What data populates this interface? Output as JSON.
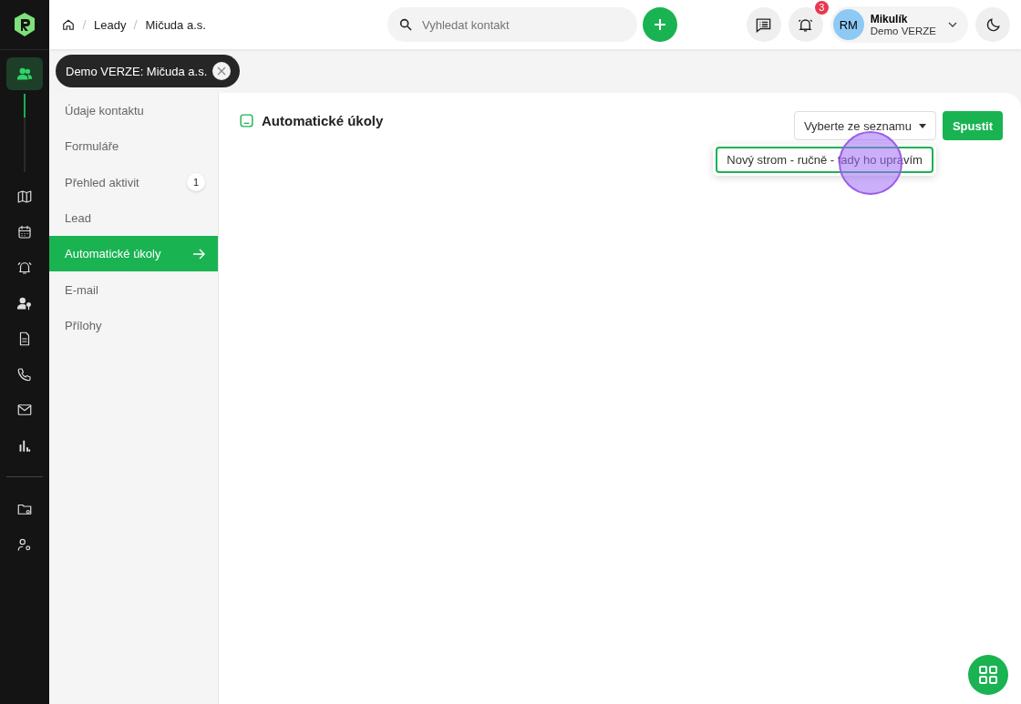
{
  "breadcrumb": [
    "Leady",
    "Mičuda a.s."
  ],
  "search": {
    "placeholder": "Vyhledat kontakt"
  },
  "notifications": {
    "count": "3"
  },
  "user": {
    "initials": "RM",
    "name": "Mikulík",
    "company": "Demo VERZE"
  },
  "rail": [
    {
      "selected": true
    },
    {
      "selected": false
    },
    {
      "selected": false
    },
    {
      "selected": false
    },
    {
      "selected": false
    },
    {
      "selected": false
    },
    {
      "selected": false
    },
    {
      "selected": false
    },
    {
      "selected": false
    },
    {
      "selected": false
    },
    {
      "selected": false
    }
  ],
  "tab_chip": {
    "label": "Demo VERZE: Mičuda a.s."
  },
  "menu": [
    {
      "label": "Údaje kontaktu",
      "selected": false
    },
    {
      "label": "Formuláře",
      "selected": false
    },
    {
      "label": "Přehled aktivit",
      "selected": false,
      "badge": "1"
    },
    {
      "label": "Lead",
      "selected": false
    },
    {
      "label": "Automatické úkoly",
      "selected": true
    },
    {
      "label": "E-mail",
      "selected": false
    },
    {
      "label": "Přílohy",
      "selected": false
    }
  ],
  "panel": {
    "title": "Automatické úkoly",
    "select": {
      "value": "Vyberte ze seznamu",
      "expanded": true,
      "options": [
        "Nový strom - ručně - tady ho upravím"
      ]
    },
    "run_button": "Spustit"
  }
}
